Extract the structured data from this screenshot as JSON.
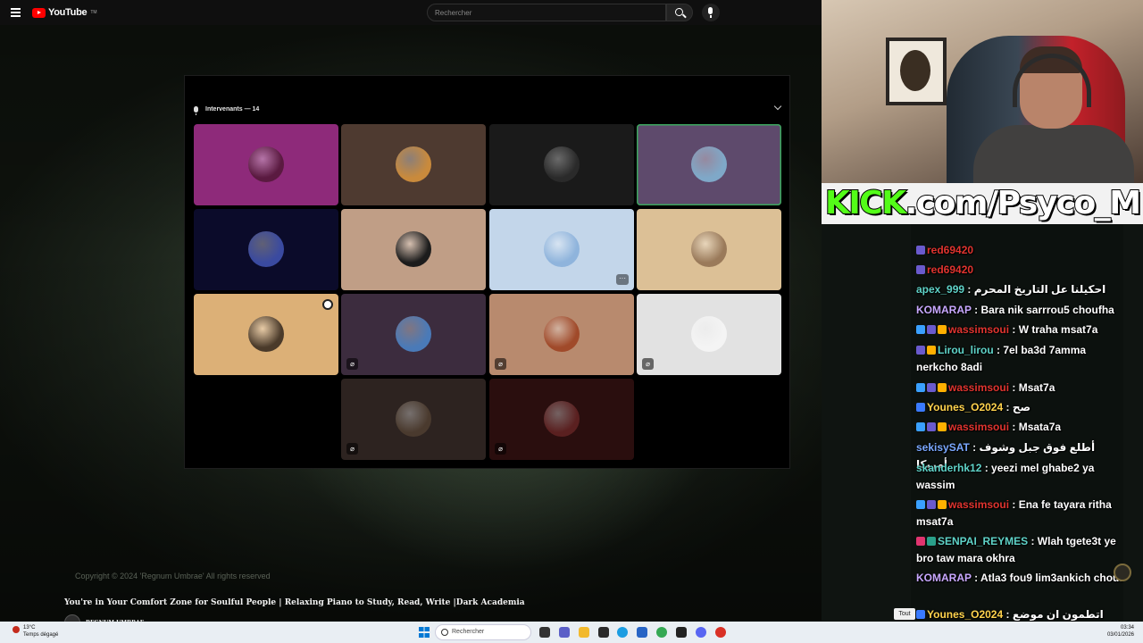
{
  "youtube": {
    "logo_text": "YouTube",
    "logo_tm": "TM",
    "search_placeholder": "Rechercher",
    "copyright": "Copyright © 2024 'Regnum Umbrae' All rights reserved",
    "video_title": "You're in Your Comfort Zone for Soulful People | Relaxing Piano to Study, Read, Write |Dark Academia",
    "channel_name": "REGNUM UMBRAE"
  },
  "stage": {
    "title": "Intervenants — 14",
    "tiles": [
      {
        "bg": "#8e2a7a",
        "avatar": "#5a1a40",
        "badge": ""
      },
      {
        "bg": "#4e3a30",
        "avatar": "#c98a3c",
        "badge": ""
      },
      {
        "bg": "#1a1a1a",
        "avatar": "#2a2a2a",
        "badge": ""
      },
      {
        "bg": "#5e4a6c",
        "avatar": "#7fa8c8",
        "badge": "",
        "active": true
      },
      {
        "bg": "#0b0b2a",
        "avatar": "#3a4aa0",
        "badge": ""
      },
      {
        "bg": "#c09e86",
        "avatar": "#1c1c1c",
        "badge": ""
      },
      {
        "bg": "#c3d6ea",
        "avatar": "#8fb4dc",
        "badge": "",
        "more": "···"
      },
      {
        "bg": "#dcc096",
        "avatar": "#9a7a5a",
        "badge": ""
      },
      {
        "bg": "#dcb077",
        "avatar": "#4a3a2a",
        "badge": "",
        "host": true
      },
      {
        "bg": "#3c2c3e",
        "avatar": "#4a7ab8",
        "badge": "🎙"
      },
      {
        "bg": "#b88a6e",
        "avatar": "#a04a2a",
        "badge": "🎙"
      },
      {
        "bg": "#e2e2e2",
        "avatar": "#f4f4f4",
        "badge": "🎙"
      },
      {
        "bg": "#2d2320",
        "avatar": "#4a3a2e",
        "badge": "🎙"
      },
      {
        "bg": "#2a0e0e",
        "avatar": "#5a2020",
        "badge": "🎙"
      }
    ]
  },
  "stream": {
    "kick_green": "KICK",
    "kick_rest": ".com/Psyco_M"
  },
  "chat": {
    "lines": [
      {
        "user": "red69420",
        "color": "#e0342f",
        "text": "",
        "badges": [
          "#6a5acd"
        ]
      },
      {
        "user": "red69420",
        "color": "#e0342f",
        "text": "",
        "badges": [
          "#6a5acd"
        ]
      },
      {
        "user": "apex_999",
        "color": "#5fd3c8",
        "text": " : احكيلنا عل التاريخ المحرم",
        "badges": []
      },
      {
        "user": "KOMARAP",
        "color": "#c8a8ff",
        "text": " : Bara nik sarrrou5 choufha",
        "badges": []
      },
      {
        "user": "wassimsoui",
        "color": "#e0342f",
        "text": " : W traha msat7a",
        "badges": [
          "#3aa0ff",
          "#6a5acd",
          "#ffb000"
        ]
      },
      {
        "user": "Lirou_lirou",
        "color": "#5fd3c8",
        "text": " : 7el ba3d 7amma nerkcho 8adi",
        "badges": [
          "#6a5acd",
          "#ffb000"
        ]
      },
      {
        "user": "wassimsoui",
        "color": "#e0342f",
        "text": " : Msat7a",
        "badges": [
          "#3aa0ff",
          "#6a5acd",
          "#ffb000"
        ]
      },
      {
        "user": "Younes_O2024",
        "color": "#ffd34d",
        "text": " : صح",
        "badges": [
          "#3a7aff"
        ]
      },
      {
        "user": "wassimsoui",
        "color": "#e0342f",
        "text": " : Msata7a",
        "badges": [
          "#3aa0ff",
          "#6a5acd",
          "#ffb000"
        ]
      },
      {
        "user": "sekisySAT",
        "color": "#7aa8ff",
        "text": " : أطلع فوق جبل وشوف أمريكا",
        "badges": []
      },
      {
        "user": "skanderhk12",
        "color": "#5fd3c8",
        "text": " : yeezi mel ghabe2 ya wassim",
        "badges": []
      },
      {
        "user": "wassimsoui",
        "color": "#e0342f",
        "text": " : Ena fe tayara ritha msat7a",
        "badges": [
          "#3aa0ff",
          "#6a5acd",
          "#ffb000"
        ]
      },
      {
        "user": "SENPAI_REYMES",
        "color": "#5fd3c8",
        "text": " : Wlah tgete3t ye bro taw mara okhra",
        "badges": [
          "#e0346f",
          "#2aa08a"
        ]
      },
      {
        "user": "KOMARAP",
        "color": "#c8a8ff",
        "text": " : Atla3 fou9 lim3ankich chouf",
        "badges": []
      },
      {
        "user": "Younes_O2024",
        "color": "#ffd34d",
        "text": " : اتطمون ان موضع مكة المكرمة دليل على كروية الارض ؟",
        "badges": [
          "#3a7aff"
        ]
      }
    ],
    "filter_label": "Tout"
  },
  "taskbar": {
    "weather_temp": "13°C",
    "weather_desc": "Temps dégagé",
    "search_placeholder": "Rechercher",
    "time": "03:34",
    "date": "03/01/2026"
  }
}
